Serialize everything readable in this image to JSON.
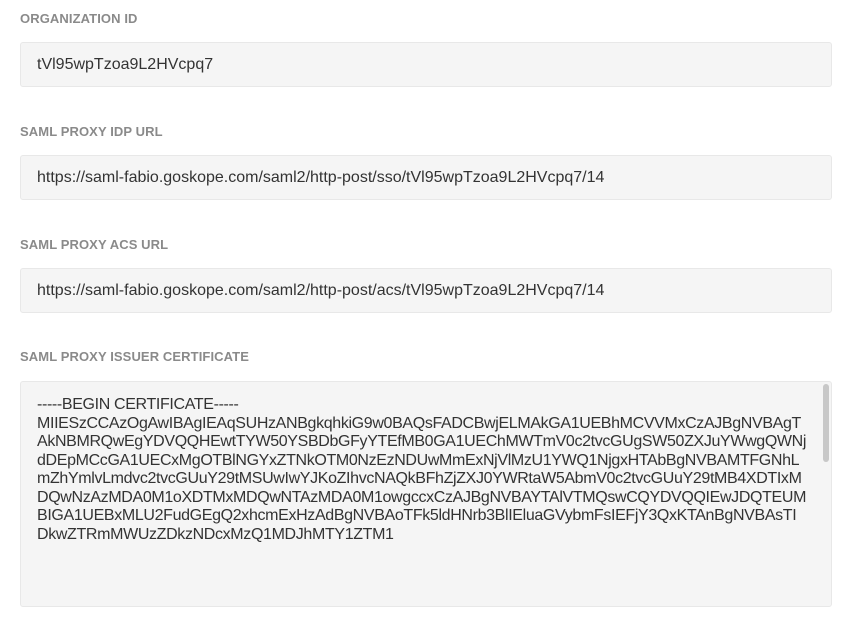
{
  "fields": {
    "organization_id": {
      "label": "ORGANIZATION ID",
      "value": "tVl95wpTzoa9L2HVcpq7"
    },
    "idp_url": {
      "label": "SAML PROXY IDP URL",
      "value": "https://saml-fabio.goskope.com/saml2/http-post/sso/tVl95wpTzoa9L2HVcpq7/14"
    },
    "acs_url": {
      "label": "SAML PROXY ACS URL",
      "value": "https://saml-fabio.goskope.com/saml2/http-post/acs/tVl95wpTzoa9L2HVcpq7/14"
    },
    "issuer_certificate": {
      "label": "SAML PROXY ISSUER CERTIFICATE",
      "value": "-----BEGIN CERTIFICATE-----\nMIIESzCCAzOgAwIBAgIEAqSUHzANBgkqhkiG9w0BAQsFADCBwjELMAkGA1UEBhMCVVMxCzAJBgNVBAgTAkNBMRQwEgYDVQQHEwtTYW50YSBDbGFyYTEfMB0GA1UEChMWTmV0c2tvcGUgSW50ZXJuYWwgQWNjdDEpMCcGA1UECxMgOTBlNGYxZTNkOTM0NzEzNDUwMmExNjVlMzU1YWQ1NjgxHTAbBgNVBAMTFGNhLmZhYmlvLmdvc2tvcGUuY29tMSUwIwYJKoZIhvcNAQkBFhZjZXJ0YWRtaW5AbmV0c2tvcGUuY29tMB4XDTIxMDQwNzAzMDA0M1oXDTMxMDQwNTAzMDA0M1owgccxCzAJBgNVBAYTAlVTMQswCQYDVQQIEwJDQTEUMBIGA1UEBxMLU2FudGEgQ2xhcmExHzAdBgNVBAoTFk5ldHNrb3BlIEluaGVybmFsIEFjY3QxKTAnBgNVBAsTIDkwZTRmMWUzZDkzNDcxMzQ1MDJhMTY1ZTM1"
    }
  }
}
